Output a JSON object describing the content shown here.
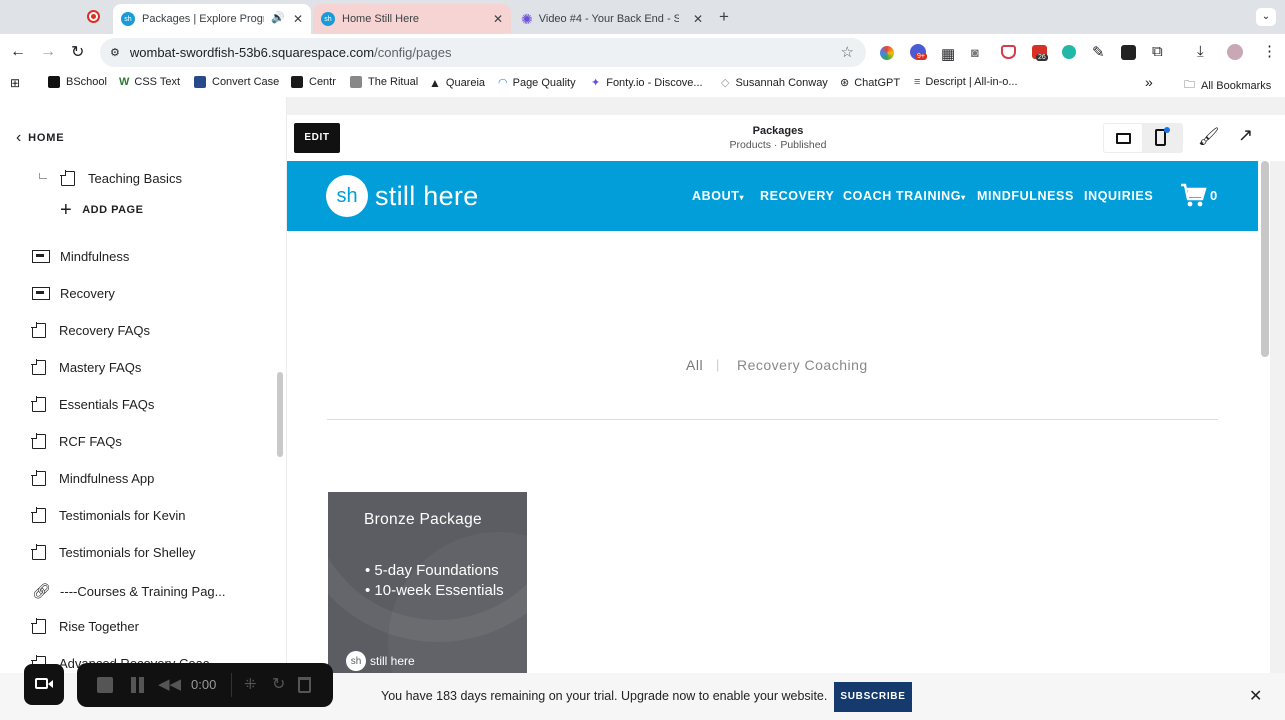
{
  "browser": {
    "tabs": [
      {
        "title": "Packages | Explore Progra",
        "favicon_text": "sh",
        "active": true
      },
      {
        "title": "Home Still Here",
        "favicon_text": "sh",
        "active": false
      },
      {
        "title": "Video #4 - Your Back End - S",
        "active": false
      }
    ],
    "new_tab_label": "+",
    "url_host": "wombat-swordfish-53b6.squarespace.com",
    "url_path": "/config/pages",
    "extension_badges": [
      "9+",
      "26"
    ],
    "bookmarks": [
      "BSchool",
      "CSS Text",
      "Convert Case",
      "Centr",
      "The Ritual",
      "Quareia",
      "Page Quality",
      "Fonty.io - Discove...",
      "Susannah Conway",
      "ChatGPT",
      "Descript | All-in-o..."
    ],
    "bookmarks_overflow": "»",
    "all_bookmarks_label": "All Bookmarks"
  },
  "sidebar": {
    "home_label": "HOME",
    "teaching_basics": "Teaching Basics",
    "add_page_label": "ADD PAGE",
    "items": [
      {
        "label": "Mindfulness",
        "icon": "folder"
      },
      {
        "label": "Recovery",
        "icon": "folder"
      },
      {
        "label": "Recovery FAQs",
        "icon": "page"
      },
      {
        "label": "Mastery FAQs",
        "icon": "page"
      },
      {
        "label": "Essentials FAQs",
        "icon": "page"
      },
      {
        "label": "RCF FAQs",
        "icon": "page"
      },
      {
        "label": "Mindfulness App",
        "icon": "page"
      },
      {
        "label": "Testimonials for Kevin",
        "icon": "page"
      },
      {
        "label": "Testimonials for Shelley",
        "icon": "page"
      },
      {
        "label": "----Courses & Training Pag...",
        "icon": "link"
      },
      {
        "label": "Rise Together",
        "icon": "page"
      },
      {
        "label": "Advanced Recovery Coac...",
        "icon": "page"
      }
    ]
  },
  "editor": {
    "edit_label": "EDIT",
    "page_title": "Packages",
    "page_subtitle": "Products · Published"
  },
  "site": {
    "logo_mark": "sh",
    "logo_text": "still here",
    "nav": [
      "ABOUT",
      "RECOVERY",
      "COACH TRAINING",
      "MINDFULNESS",
      "INQUIRIES"
    ],
    "dropdown_caret": "▾",
    "cart_count": "0",
    "filters": [
      "All",
      "Recovery Coaching"
    ],
    "filter_separator": "|",
    "product": {
      "title": "Bronze Package",
      "bullets": [
        "5-day Foundations",
        "10-week Essentials"
      ],
      "logo_mark": "sh",
      "logo_text": "still here"
    }
  },
  "trial": {
    "message": "You have 183 days remaining on your trial. Upgrade now to enable your website.",
    "subscribe_label": "SUBSCRIBE"
  },
  "recorder": {
    "time": "0:00"
  },
  "colors": {
    "brand_blue": "#019ed9",
    "subscribe_navy": "#143a6e",
    "product_gray": "#5b5d62"
  }
}
